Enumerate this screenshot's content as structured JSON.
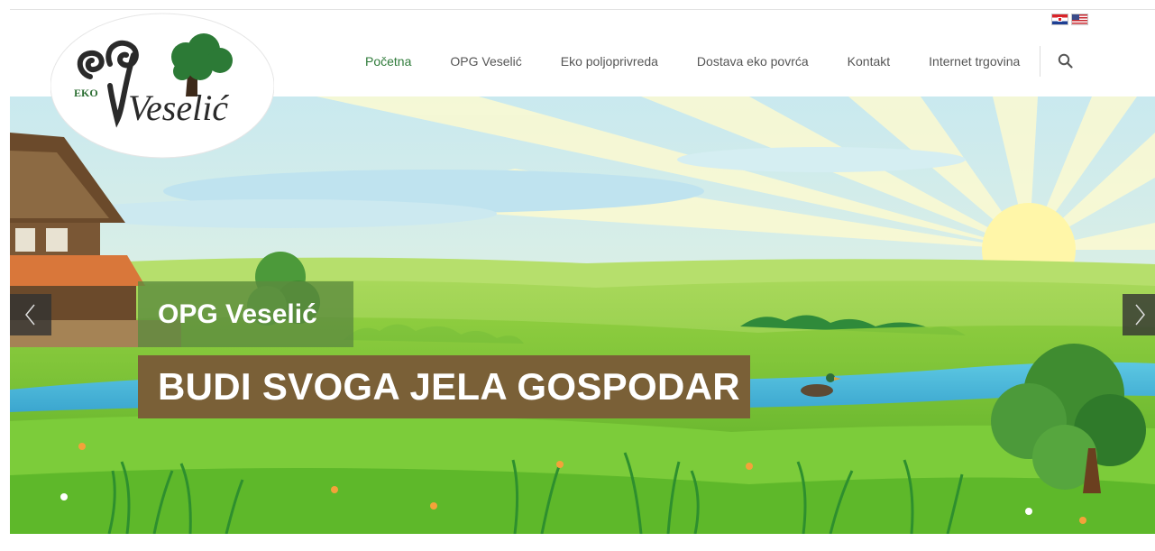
{
  "site": {
    "logo": {
      "text": "Veselić",
      "prefix": "EKO"
    },
    "languages": [
      {
        "code": "hr",
        "icon": "croatian-flag-icon"
      },
      {
        "code": "en",
        "icon": "us-flag-icon"
      }
    ],
    "nav": [
      {
        "label": "Početna",
        "active": true
      },
      {
        "label": "OPG Veselić",
        "active": false
      },
      {
        "label": "Eko poljoprivreda",
        "active": false
      },
      {
        "label": "Dostava eko povrća",
        "active": false
      },
      {
        "label": "Kontakt",
        "active": false
      },
      {
        "label": "Internet trgovina",
        "active": false
      }
    ],
    "search_icon": "search-icon"
  },
  "hero": {
    "subtitle": "OPG Veselić",
    "headline": "BUDI SVOGA JELA GOSPODAR",
    "prev_icon": "chevron-left-icon",
    "next_icon": "chevron-right-icon"
  },
  "colors": {
    "nav_active": "#2f7b3a",
    "nav_text": "#555555",
    "caption_green": "#5c8a3f",
    "caption_brown": "#7a6037",
    "logo_green": "#2c6e33"
  }
}
